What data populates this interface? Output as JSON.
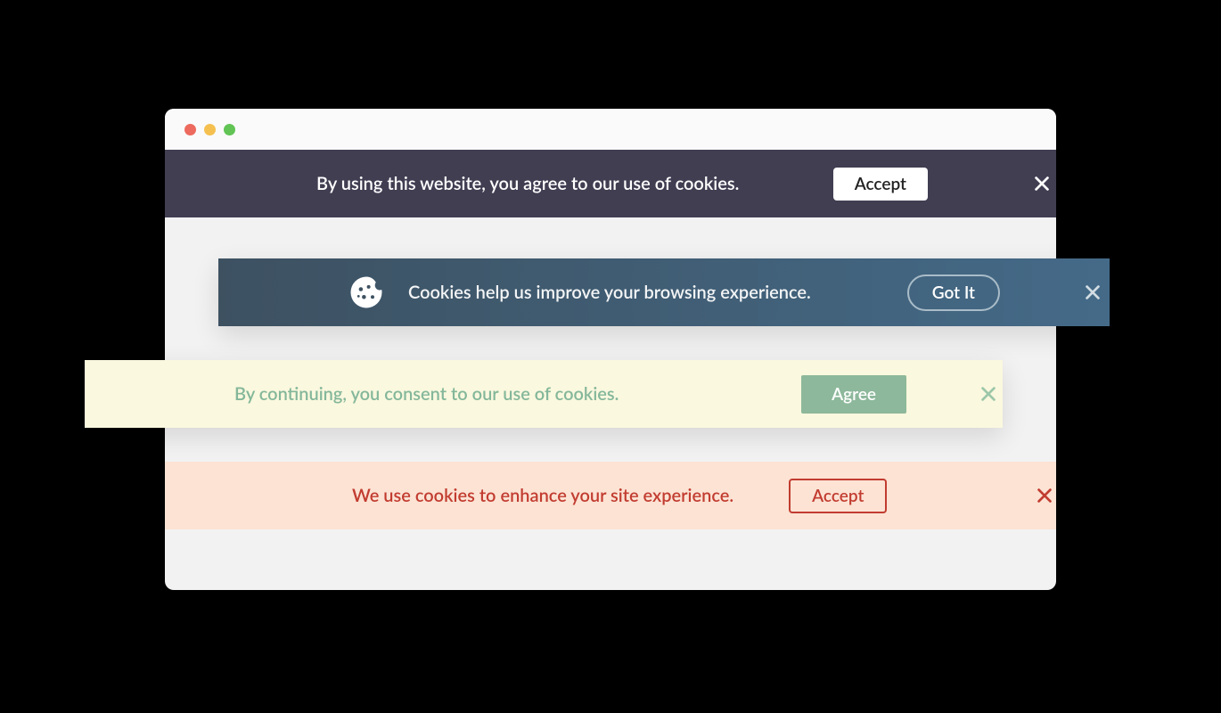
{
  "banners": [
    {
      "message": "By using this website, you agree to our use of cookies.",
      "button": "Accept"
    },
    {
      "message": "Cookies help us improve your browsing experience.",
      "button": "Got It"
    },
    {
      "message": "By continuing, you consent to our use of cookies.",
      "button": "Agree"
    },
    {
      "message": "We use cookies to enhance your site experience.",
      "button": "Accept"
    }
  ]
}
